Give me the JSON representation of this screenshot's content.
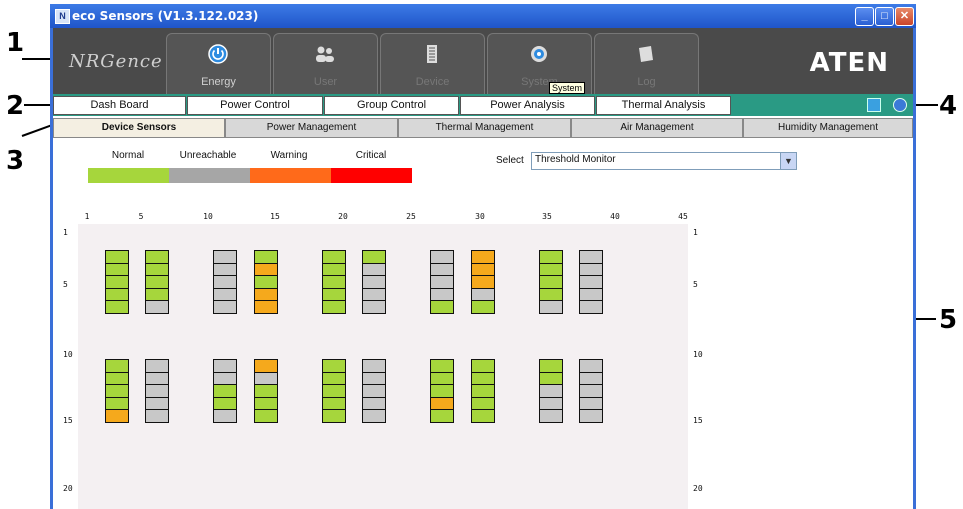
{
  "callouts": [
    "1",
    "2",
    "3",
    "4",
    "5"
  ],
  "window": {
    "title": "eco Sensors (V1.3.122.023)",
    "icon": "app-icon",
    "buttons": [
      "minimize",
      "maximize",
      "close"
    ]
  },
  "topbar": {
    "brand_logo": "NRGence",
    "vendor_logo": "ATEN",
    "tabs": [
      {
        "label": "Energy",
        "icon": "power-icon",
        "dim": false
      },
      {
        "label": "User",
        "icon": "users-icon",
        "dim": true
      },
      {
        "label": "Device",
        "icon": "device-icon",
        "dim": true
      },
      {
        "label": "System",
        "icon": "gear-icon",
        "dim": true
      },
      {
        "label": "Log",
        "icon": "log-icon",
        "dim": true
      }
    ],
    "tooltip": "System"
  },
  "menu": {
    "items": [
      "Dash Board",
      "Power Control",
      "Group Control",
      "Power Analysis",
      "Thermal Analysis"
    ],
    "icons": [
      "monitor-icon",
      "logout-icon"
    ]
  },
  "subtabs": {
    "items": [
      "Device Sensors",
      "Power Management",
      "Thermal Management",
      "Air Management",
      "Humidity Management"
    ],
    "active": "Device Sensors"
  },
  "legend": [
    {
      "label": "Normal",
      "color": "#a6d63c"
    },
    {
      "label": "Unreachable",
      "color": "#a6a6a6"
    },
    {
      "label": "Warning",
      "color": "#ff6a1a"
    },
    {
      "label": "Critical",
      "color": "#ff0000"
    }
  ],
  "select": {
    "label": "Select",
    "value": "Threshold Monitor"
  },
  "grid": {
    "x_ticks": [
      "1",
      "5",
      "10",
      "15",
      "20",
      "25",
      "30",
      "35",
      "40",
      "45"
    ],
    "y_ticks": [
      "1",
      "5",
      "10",
      "15",
      "20"
    ],
    "colors": {
      "N": "#a6d63c",
      "U": "#c8c8c8",
      "W": "#f5a91c"
    },
    "racks": [
      {
        "col": 1,
        "row": 0,
        "cells": [
          "N",
          "N",
          "N",
          "N",
          "N"
        ]
      },
      {
        "col": 2,
        "row": 0,
        "cells": [
          "N",
          "N",
          "N",
          "N",
          "U"
        ]
      },
      {
        "col": 3,
        "row": 0,
        "cells": [
          "U",
          "U",
          "U",
          "U",
          "U"
        ]
      },
      {
        "col": 4,
        "row": 0,
        "cells": [
          "N",
          "W",
          "N",
          "W",
          "W"
        ]
      },
      {
        "col": 5,
        "row": 0,
        "cells": [
          "N",
          "N",
          "N",
          "N",
          "N"
        ]
      },
      {
        "col": 6,
        "row": 0,
        "cells": [
          "N",
          "U",
          "U",
          "U",
          "U"
        ]
      },
      {
        "col": 7,
        "row": 0,
        "cells": [
          "U",
          "U",
          "U",
          "U",
          "N"
        ]
      },
      {
        "col": 8,
        "row": 0,
        "cells": [
          "W",
          "W",
          "W",
          "U",
          "N"
        ]
      },
      {
        "col": 9,
        "row": 0,
        "cells": [
          "N",
          "N",
          "N",
          "N",
          "U"
        ]
      },
      {
        "col": 10,
        "row": 0,
        "cells": [
          "U",
          "U",
          "U",
          "U",
          "U"
        ]
      },
      {
        "col": 1,
        "row": 1,
        "cells": [
          "N",
          "N",
          "N",
          "N",
          "W"
        ]
      },
      {
        "col": 2,
        "row": 1,
        "cells": [
          "U",
          "U",
          "U",
          "U",
          "U"
        ]
      },
      {
        "col": 3,
        "row": 1,
        "cells": [
          "U",
          "U",
          "N",
          "N",
          "U"
        ]
      },
      {
        "col": 4,
        "row": 1,
        "cells": [
          "W",
          "U",
          "N",
          "N",
          "N"
        ]
      },
      {
        "col": 5,
        "row": 1,
        "cells": [
          "N",
          "N",
          "N",
          "N",
          "N"
        ]
      },
      {
        "col": 6,
        "row": 1,
        "cells": [
          "U",
          "U",
          "U",
          "U",
          "U"
        ]
      },
      {
        "col": 7,
        "row": 1,
        "cells": [
          "N",
          "N",
          "N",
          "W",
          "N"
        ]
      },
      {
        "col": 8,
        "row": 1,
        "cells": [
          "N",
          "N",
          "N",
          "N",
          "N"
        ]
      },
      {
        "col": 9,
        "row": 1,
        "cells": [
          "N",
          "N",
          "U",
          "U",
          "U"
        ]
      },
      {
        "col": 10,
        "row": 1,
        "cells": [
          "U",
          "U",
          "U",
          "U",
          "U"
        ]
      }
    ]
  }
}
